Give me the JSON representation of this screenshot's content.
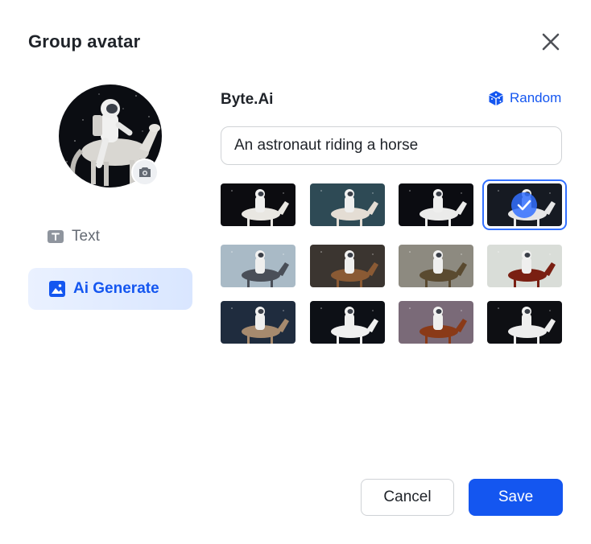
{
  "dialog": {
    "title": "Group avatar",
    "close_icon": "close-icon"
  },
  "avatar": {
    "subject": "astronaut riding a horse",
    "camera_icon": "camera-icon"
  },
  "nav": {
    "items": [
      {
        "label": "Text",
        "icon": "text-icon",
        "active": false
      },
      {
        "label": "Ai Generate",
        "icon": "image-icon",
        "active": true
      }
    ]
  },
  "generator": {
    "brand": "Byte.Ai",
    "random_label": "Random",
    "random_icon": "dice-icon",
    "prompt_value": "An astronaut riding a horse",
    "selected_index": 3,
    "thumbnails": [
      {
        "bg": "#0c0c10",
        "horse": "#e9e7e2"
      },
      {
        "bg": "#2e4a55",
        "horse": "#e4ddd4"
      },
      {
        "bg": "#0b0c11",
        "horse": "#ebebea"
      },
      {
        "bg": "#161a22",
        "horse": "#e6e6e6"
      },
      {
        "bg": "#a9bac6",
        "horse": "#4a4f58"
      },
      {
        "bg": "#3b3530",
        "horse": "#8a5a34"
      },
      {
        "bg": "#8d8a80",
        "horse": "#5a4a30"
      },
      {
        "bg": "#d9ddd8",
        "horse": "#7a1f12"
      },
      {
        "bg": "#1f2c3e",
        "horse": "#a68a6e"
      },
      {
        "bg": "#0d1016",
        "horse": "#f0f0f0"
      },
      {
        "bg": "#7a6a78",
        "horse": "#8a3a18"
      },
      {
        "bg": "#0e0f13",
        "horse": "#ededed"
      }
    ]
  },
  "actions": {
    "cancel_label": "Cancel",
    "save_label": "Save"
  },
  "colors": {
    "accent": "#1456f0",
    "selection": "#3370ff"
  }
}
